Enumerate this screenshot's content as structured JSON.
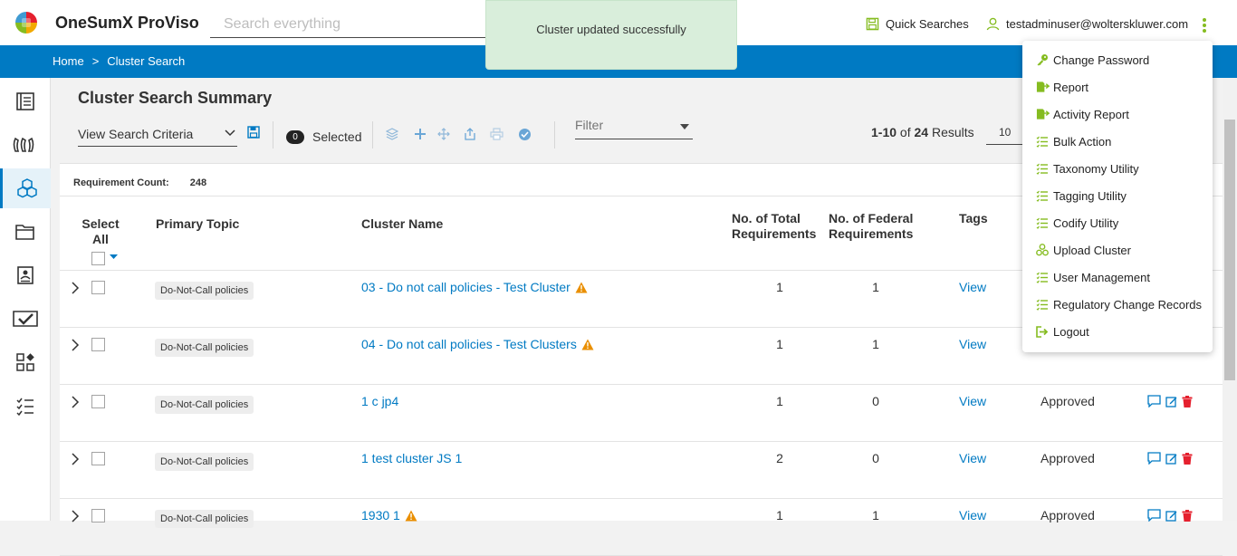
{
  "app": {
    "title": "OneSumX ProViso"
  },
  "search": {
    "placeholder": "Search everything"
  },
  "toast": {
    "message": "Cluster updated successfully"
  },
  "header": {
    "quick_searches": "Quick Searches",
    "user_email": "testadminuser@wolterskluwer.com"
  },
  "breadcrumb": {
    "home": "Home",
    "separator": ">",
    "current": "Cluster Search"
  },
  "sidebar": {
    "items": [
      {
        "icon": "document-list-icon",
        "active": false
      },
      {
        "icon": "quote-icon",
        "active": false
      },
      {
        "icon": "cubes-icon",
        "active": true
      },
      {
        "icon": "folder-icon",
        "active": false
      },
      {
        "icon": "person-doc-icon",
        "active": false
      },
      {
        "icon": "task-check-icon",
        "active": false
      },
      {
        "icon": "widgets-icon",
        "active": false
      },
      {
        "icon": "checklist-icon",
        "active": false
      }
    ]
  },
  "summary": {
    "title": "Cluster Search Summary",
    "view_criteria": "View Search Criteria",
    "selected_count": "0",
    "selected_label": "Selected",
    "filter_placeholder": "Filter",
    "results_range": "1-10",
    "results_of": "of",
    "results_total": "24",
    "results_label": "Results",
    "per_page": "10"
  },
  "grid": {
    "requirement_count_label": "Requirement Count:",
    "requirement_count": "248",
    "headers": {
      "select_all": "Select All",
      "primary_topic": "Primary Topic",
      "cluster_name": "Cluster Name",
      "total_req": "No. of Total Requirements",
      "federal_req": "No. of Federal Requirements",
      "tags": "Tags"
    },
    "rows": [
      {
        "topic": "Do-Not-Call policies",
        "name": "03 - Do not call policies - Test Cluster",
        "warning": true,
        "total": "1",
        "federal": "1",
        "tags": "View",
        "status": ""
      },
      {
        "topic": "Do-Not-Call policies",
        "name": "04 - Do not call policies - Test Clusters",
        "warning": true,
        "total": "1",
        "federal": "1",
        "tags": "View",
        "status": ""
      },
      {
        "topic": "Do-Not-Call policies",
        "name": "1 c jp4",
        "warning": false,
        "total": "1",
        "federal": "0",
        "tags": "View",
        "status": "Approved"
      },
      {
        "topic": "Do-Not-Call policies",
        "name": "1 test cluster JS 1",
        "warning": false,
        "total": "2",
        "federal": "0",
        "tags": "View",
        "status": "Approved"
      },
      {
        "topic": "Do-Not-Call policies",
        "name": "1930 1",
        "warning": true,
        "total": "1",
        "federal": "1",
        "tags": "View",
        "status": "Approved"
      }
    ]
  },
  "user_menu": {
    "items": [
      {
        "label": "Change Password",
        "icon": "key-icon"
      },
      {
        "label": "Report",
        "icon": "report-export-icon"
      },
      {
        "label": "Activity Report",
        "icon": "activity-report-icon"
      },
      {
        "label": "Bulk Action",
        "icon": "list-check-icon"
      },
      {
        "label": "Taxonomy Utility",
        "icon": "list-check-icon"
      },
      {
        "label": "Tagging Utility",
        "icon": "list-check-icon"
      },
      {
        "label": "Codify Utility",
        "icon": "list-check-icon"
      },
      {
        "label": "Upload Cluster",
        "icon": "cluster-icon"
      },
      {
        "label": "User Management",
        "icon": "list-check-icon"
      },
      {
        "label": "Regulatory Change Records",
        "icon": "list-check-icon"
      },
      {
        "label": "Logout",
        "icon": "logout-icon"
      }
    ]
  },
  "colors": {
    "brand_blue": "#007ac3",
    "accent_green": "#85bc20",
    "delete_red": "#e5202e",
    "warning_orange": "#ea8f00"
  }
}
